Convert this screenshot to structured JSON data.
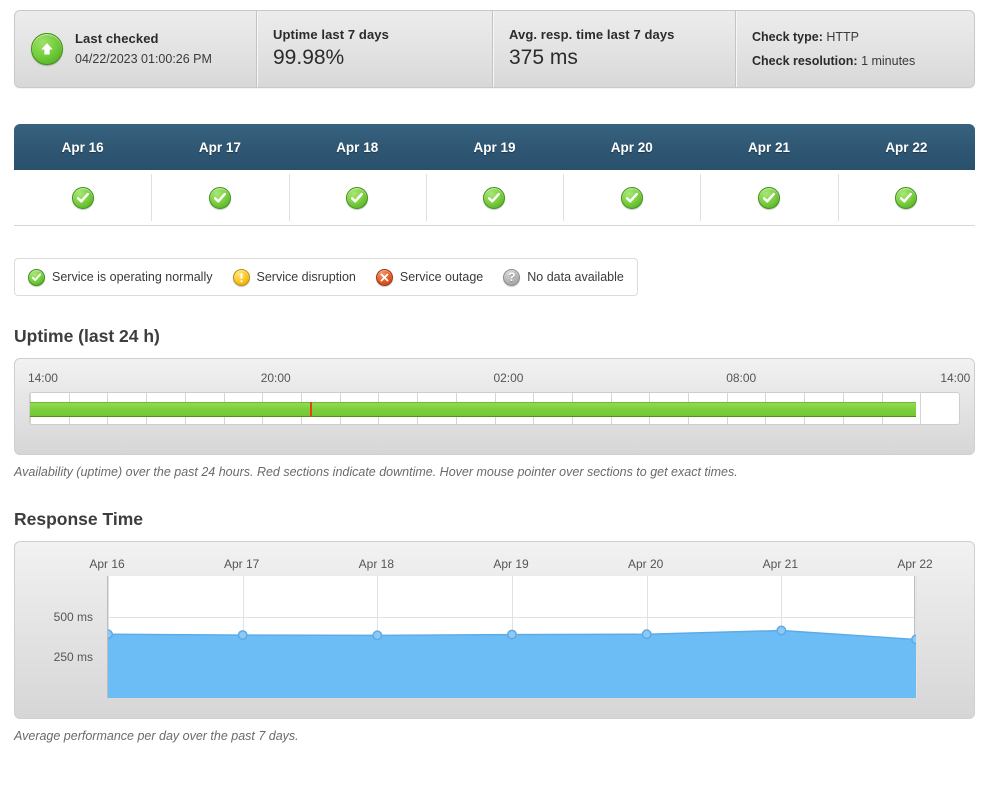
{
  "summary": {
    "status_icon": "arrow-up-icon",
    "last_checked": {
      "label": "Last checked",
      "value": "04/22/2023 01:00:26 PM"
    },
    "uptime": {
      "label": "Uptime last 7 days",
      "value": "99.98%"
    },
    "response": {
      "label": "Avg. resp. time last 7 days",
      "value": "375 ms"
    },
    "check_type": {
      "label": "Check type:",
      "value": "HTTP"
    },
    "check_resolution": {
      "label": "Check resolution:",
      "value": "1 minutes"
    }
  },
  "day_status": {
    "days": [
      {
        "date": "Apr 16",
        "status": "ok"
      },
      {
        "date": "Apr 17",
        "status": "ok"
      },
      {
        "date": "Apr 18",
        "status": "ok"
      },
      {
        "date": "Apr 19",
        "status": "ok"
      },
      {
        "date": "Apr 20",
        "status": "ok"
      },
      {
        "date": "Apr 21",
        "status": "ok"
      },
      {
        "date": "Apr 22",
        "status": "ok"
      }
    ]
  },
  "legend": {
    "items": [
      {
        "icon": "check-circle-icon",
        "label": "Service is operating normally",
        "color": "#7ed143"
      },
      {
        "icon": "exclamation-circle-icon",
        "label": "Service disruption",
        "color": "#fbcb2a"
      },
      {
        "icon": "x-circle-icon",
        "label": "Service outage",
        "color": "#e2602c"
      },
      {
        "icon": "question-circle-icon",
        "label": "No data available",
        "color": "#b9b9b9"
      }
    ]
  },
  "uptime_section": {
    "title": "Uptime (last 24 h)",
    "caption": "Availability (uptime) over the past 24 hours. Red sections indicate downtime. Hover mouse pointer over sections to get exact times."
  },
  "response_section": {
    "title": "Response Time",
    "caption": "Average performance per day over the past 7 days."
  },
  "chart_data": [
    {
      "type": "bar",
      "name": "uptime-timeline",
      "title": "Uptime (last 24 h)",
      "xlabel": "",
      "ylabel": "",
      "tick_labels": [
        "14:00",
        "20:00",
        "02:00",
        "08:00",
        "14:00"
      ],
      "tick_positions_pct": [
        1.5,
        26.5,
        51.5,
        76.5,
        99.5
      ],
      "hour_ticks": 24,
      "segments": [
        {
          "status": "up",
          "start_pct": 0.0,
          "end_pct": 30.1,
          "color": "#7ccf3b"
        },
        {
          "status": "down",
          "start_pct": 30.1,
          "end_pct": 30.4,
          "color": "#e8401f"
        },
        {
          "status": "up",
          "start_pct": 30.4,
          "end_pct": 95.4,
          "color": "#7ccf3b"
        },
        {
          "status": "nodata",
          "start_pct": 95.4,
          "end_pct": 100.0,
          "color": "#ffffff"
        }
      ],
      "grid": true
    },
    {
      "type": "area",
      "name": "response-time",
      "title": "Response Time",
      "xlabel": "",
      "ylabel": "ms",
      "categories": [
        "Apr 16",
        "Apr 17",
        "Apr 18",
        "Apr 19",
        "Apr 20",
        "Apr 21",
        "Apr 22"
      ],
      "series": [
        {
          "name": "Avg response time",
          "values": [
            392,
            387,
            385,
            390,
            392,
            415,
            360
          ]
        }
      ],
      "ytick_labels": [
        "500 ms",
        "250 ms"
      ],
      "ytick_values": [
        500,
        250
      ],
      "ylim": [
        0,
        750
      ],
      "grid": true,
      "legend_position": "none",
      "line_color": "#5aabe8",
      "fill_color": "#6cbcf5",
      "marker_color": "#8dc9f2"
    }
  ]
}
